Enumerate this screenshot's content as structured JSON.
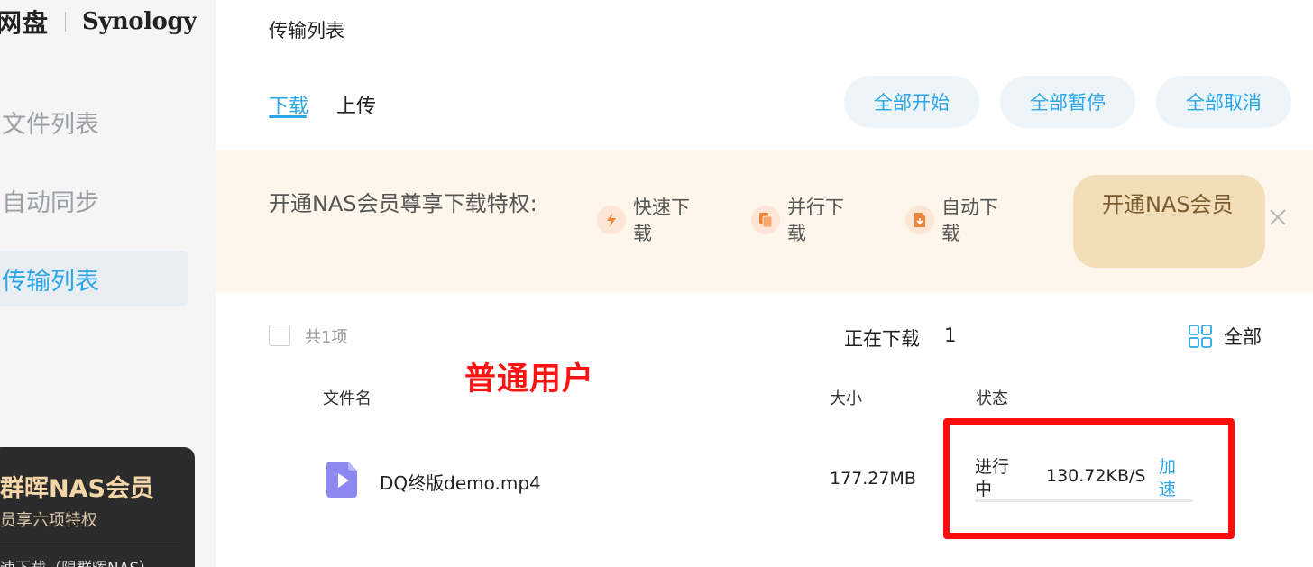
{
  "sidebar": {
    "brand_cn": "网盘",
    "brand_logo": "Synology",
    "items": [
      {
        "label": "文件列表",
        "active": false
      },
      {
        "label": "自动同步",
        "active": false
      },
      {
        "label": "传输列表",
        "active": true
      }
    ],
    "promo": {
      "title": "群晖NAS会员",
      "subtitle": "员享六项特权",
      "feature": "速下载（限群晖NAS）"
    }
  },
  "header": {
    "title": "传输列表",
    "tabs": [
      {
        "label": "下载",
        "active": true
      },
      {
        "label": "上传",
        "active": false
      }
    ],
    "actions": {
      "start_all": "全部开始",
      "pause_all": "全部暂停",
      "cancel_all": "全部取消"
    }
  },
  "banner": {
    "text": "开通NAS会员尊享下载特权:",
    "features": [
      {
        "label": "快速下载",
        "icon": "lightning-icon"
      },
      {
        "label": "并行下载",
        "icon": "parallel-icon"
      },
      {
        "label": "自动下载",
        "icon": "auto-download-icon"
      }
    ],
    "cta": "开通NAS会员",
    "close_icon": "close-icon"
  },
  "list": {
    "count": "共1项",
    "downloading_label": "正在下载",
    "downloading_count": "1",
    "filter_label": "全部",
    "columns": {
      "name": "文件名",
      "size": "大小",
      "status": "状态"
    },
    "rows": [
      {
        "name": "DQ终版demo.mp4",
        "size": "177.27MB",
        "status": "进行中",
        "speed": "130.72KB/S",
        "accelerate": "加速",
        "progress": 0
      }
    ]
  },
  "annotation": "普通用户",
  "colors": {
    "accent": "#2aa6e6",
    "annotation": "#ff1212",
    "banner_bg": "#fef6ea",
    "cta_bg": "#f2dfb9"
  }
}
